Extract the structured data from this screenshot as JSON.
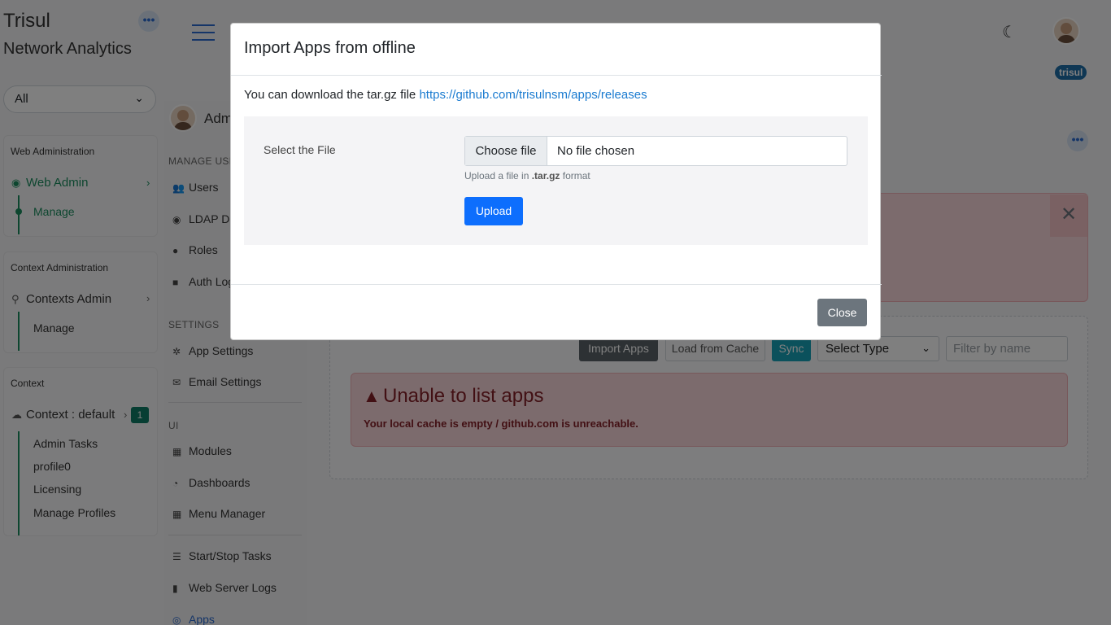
{
  "brand": {
    "title": "Trisul",
    "subtitle": "Network Analytics"
  },
  "context_select": {
    "value": "All"
  },
  "sidebar": {
    "web_admin_section": {
      "heading": "Web Administration",
      "item": "Web Admin",
      "sub": "Manage"
    },
    "context_admin_section": {
      "heading": "Context Administration",
      "item": "Contexts Admin",
      "sub": "Manage"
    },
    "context_section": {
      "heading": "Context",
      "item": "Context : default",
      "badge": "1",
      "subs": [
        "Admin Tasks",
        "profile0",
        "Licensing",
        "Manage Profiles"
      ]
    }
  },
  "header": {
    "user_badge": "trisul"
  },
  "admin_panel": {
    "title": "Adm"
  },
  "admin_menu": {
    "manage_users_heading": "MANAGE USE",
    "users": "Users",
    "ldap": "LDAP Do",
    "roles": "Roles",
    "auth_logs": "Auth Log",
    "settings_heading": "SETTINGS",
    "app_settings": "App Settings",
    "email_settings": "Email Settings",
    "ui_heading": "UI",
    "modules": "Modules",
    "dashboards": "Dashboards",
    "menu_manager": "Menu Manager",
    "start_stop": "Start/Stop Tasks",
    "web_logs": "Web Server Logs",
    "apps": "Apps"
  },
  "apps_toolbar": {
    "import_apps": "Import Apps",
    "load_cache": "Load from Cache",
    "sync": "Sync",
    "select_type": "Select Type",
    "filter_placeholder": "Filter by name"
  },
  "apps_alert": {
    "title": "Unable to list apps",
    "message": "Your local cache is empty / github.com is unreachable."
  },
  "modal": {
    "title": "Import Apps from offline",
    "note_prefix": "You can download the tar.gz file ",
    "link": "https://github.com/trisulnsm/apps/releases",
    "file_label": "Select the File",
    "choose_file": "Choose file",
    "file_status": "No file chosen",
    "hint_prefix": "Upload a file in ",
    "hint_format": ".tar.gz",
    "hint_suffix": " format",
    "upload": "Upload",
    "close": "Close"
  },
  "colors": {
    "accent_green": "#1a8d5f",
    "primary_blue": "#0d6efd",
    "danger_text": "#842029"
  },
  "icons": [
    "ellipsis-icon",
    "chevron-down-icon",
    "globe-icon",
    "chevron-right-icon",
    "wrench-icon",
    "cloud-icon",
    "hamburger-icon",
    "moon-icon",
    "users-icon",
    "user-icon",
    "lock-icon",
    "gear-icon",
    "envelope-icon",
    "grid-icon",
    "gauge-icon",
    "list-icon",
    "file-icon",
    "github-icon",
    "close-icon",
    "warning-icon"
  ]
}
